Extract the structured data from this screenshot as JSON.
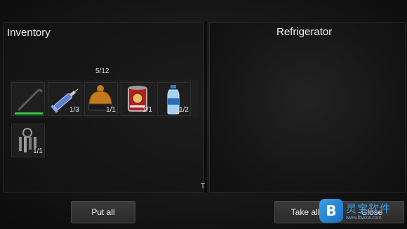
{
  "inventory": {
    "title": "Inventory",
    "capacity": "5/12",
    "items": [
      {
        "name": "crowbar-icon",
        "count": "",
        "durability": 1.0
      },
      {
        "name": "syringe-icon",
        "count": "1/3"
      },
      {
        "name": "beanie-hat-icon",
        "count": "1/1"
      },
      {
        "name": "canned-food-icon",
        "count": "1/1"
      },
      {
        "name": "water-bottle-icon",
        "count": "1/2"
      },
      {
        "name": "keys-icon",
        "count": "1/1"
      }
    ]
  },
  "container": {
    "title": "Refrigerator"
  },
  "buttons": {
    "put_all": "Put all",
    "take_all": "Take all",
    "close": "Close"
  },
  "cursor_mark": "T",
  "watermark": {
    "logo": "B",
    "name": "灵宝软件",
    "url": "www.lbwxw.com"
  },
  "colors": {
    "durability_bar": "#2ecc40",
    "accent_watermark": "#3aa0e8"
  }
}
